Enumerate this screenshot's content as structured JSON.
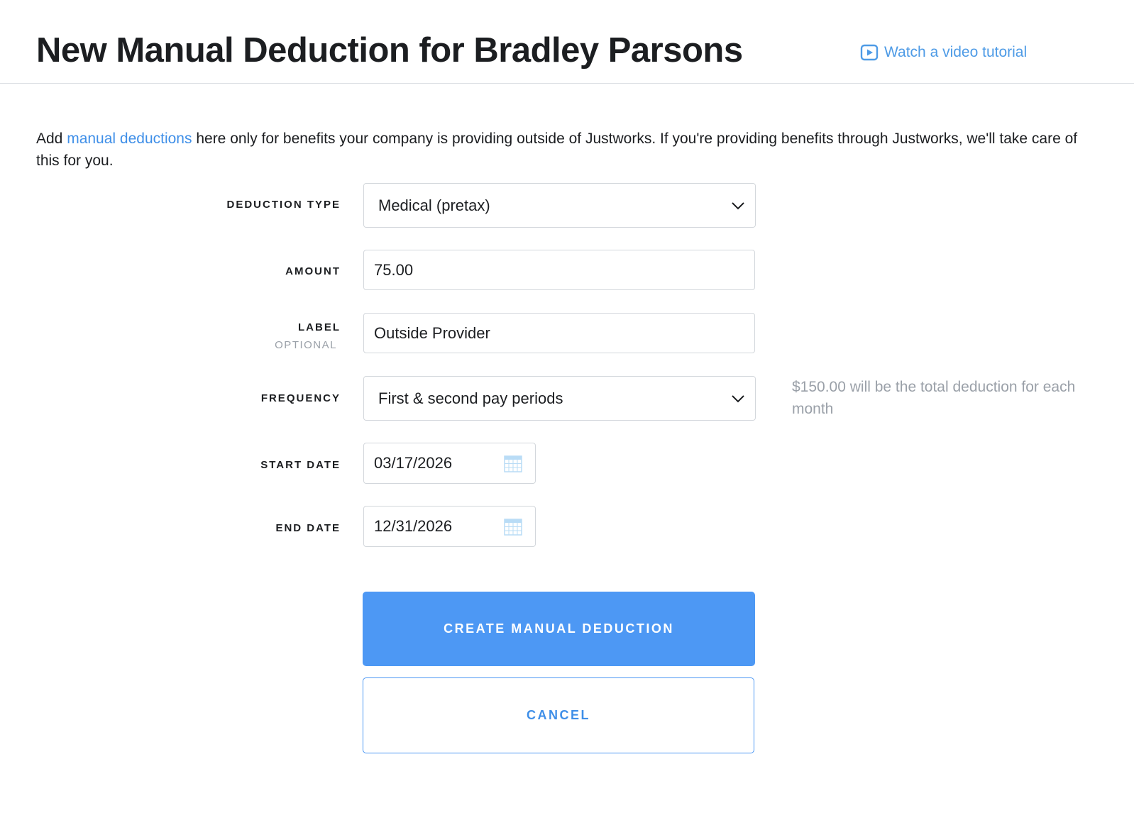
{
  "header": {
    "title": "New Manual Deduction for Bradley Parsons",
    "video_link": "Watch a video tutorial"
  },
  "intro": {
    "prefix": "Add ",
    "link": "manual deductions",
    "suffix": " here only for benefits your company is providing outside of Justworks. If you're providing benefits through Justworks, we'll take care of this for you."
  },
  "form": {
    "deduction_type": {
      "label": "DEDUCTION TYPE",
      "value": "Medical (pretax)"
    },
    "amount": {
      "label": "AMOUNT",
      "value": "75.00"
    },
    "label": {
      "label": "LABEL",
      "sublabel": "OPTIONAL",
      "value": "Outside Provider"
    },
    "frequency": {
      "label": "FREQUENCY",
      "value": "First & second pay periods",
      "hint": "$150.00 will be the total deduction for each month"
    },
    "start_date": {
      "label": "START DATE",
      "value": "03/17/2026"
    },
    "end_date": {
      "label": "END DATE",
      "value": "12/31/2026"
    }
  },
  "actions": {
    "create": "CREATE MANUAL DEDUCTION",
    "cancel": "CANCEL"
  },
  "colors": {
    "accent": "#4d98f4",
    "link": "#3f8fe8",
    "muted": "#9aa0a8",
    "calendar_icon": "#b9dcf6"
  }
}
